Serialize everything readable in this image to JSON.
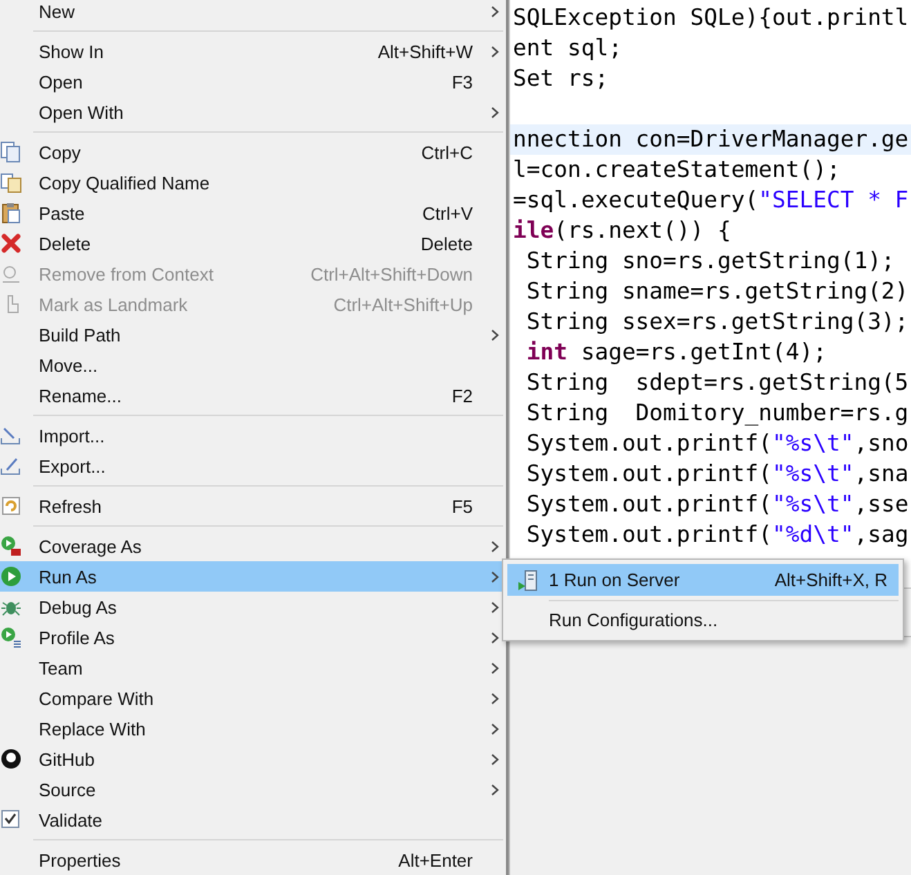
{
  "context_menu": {
    "items": [
      {
        "kind": "item",
        "label": "New",
        "submenu": true,
        "disabled": false,
        "selected": false
      },
      {
        "kind": "separator"
      },
      {
        "kind": "item",
        "label": "Show In",
        "shortcut": "Alt+Shift+W",
        "submenu": true,
        "disabled": false,
        "selected": false
      },
      {
        "kind": "item",
        "label": "Open",
        "shortcut": "F3",
        "submenu": false,
        "disabled": false,
        "selected": false
      },
      {
        "kind": "item",
        "label": "Open With",
        "submenu": true,
        "disabled": false,
        "selected": false
      },
      {
        "kind": "separator"
      },
      {
        "kind": "item",
        "label": "Copy",
        "shortcut": "Ctrl+C",
        "submenu": false,
        "disabled": false,
        "selected": false
      },
      {
        "kind": "item",
        "label": "Copy Qualified Name",
        "submenu": false,
        "disabled": false,
        "selected": false
      },
      {
        "kind": "item",
        "label": "Paste",
        "shortcut": "Ctrl+V",
        "submenu": false,
        "disabled": false,
        "selected": false
      },
      {
        "kind": "item",
        "label": "Delete",
        "shortcut": "Delete",
        "submenu": false,
        "disabled": false,
        "selected": false
      },
      {
        "kind": "item",
        "label": "Remove from Context",
        "shortcut": "Ctrl+Alt+Shift+Down",
        "submenu": false,
        "disabled": true,
        "selected": false
      },
      {
        "kind": "item",
        "label": "Mark as Landmark",
        "shortcut": "Ctrl+Alt+Shift+Up",
        "submenu": false,
        "disabled": true,
        "selected": false
      },
      {
        "kind": "item",
        "label": "Build Path",
        "submenu": true,
        "disabled": false,
        "selected": false
      },
      {
        "kind": "item",
        "label": "Move...",
        "submenu": false,
        "disabled": false,
        "selected": false
      },
      {
        "kind": "item",
        "label": "Rename...",
        "shortcut": "F2",
        "submenu": false,
        "disabled": false,
        "selected": false
      },
      {
        "kind": "separator"
      },
      {
        "kind": "item",
        "label": "Import...",
        "submenu": false,
        "disabled": false,
        "selected": false
      },
      {
        "kind": "item",
        "label": "Export...",
        "submenu": false,
        "disabled": false,
        "selected": false
      },
      {
        "kind": "separator"
      },
      {
        "kind": "item",
        "label": "Refresh",
        "shortcut": "F5",
        "submenu": false,
        "disabled": false,
        "selected": false
      },
      {
        "kind": "separator"
      },
      {
        "kind": "item",
        "label": "Coverage As",
        "submenu": true,
        "disabled": false,
        "selected": false
      },
      {
        "kind": "item",
        "label": "Run As",
        "submenu": true,
        "disabled": false,
        "selected": true
      },
      {
        "kind": "item",
        "label": "Debug As",
        "submenu": true,
        "disabled": false,
        "selected": false
      },
      {
        "kind": "item",
        "label": "Profile As",
        "submenu": true,
        "disabled": false,
        "selected": false
      },
      {
        "kind": "item",
        "label": "Team",
        "submenu": true,
        "disabled": false,
        "selected": false
      },
      {
        "kind": "item",
        "label": "Compare With",
        "submenu": true,
        "disabled": false,
        "selected": false
      },
      {
        "kind": "item",
        "label": "Replace With",
        "submenu": true,
        "disabled": false,
        "selected": false
      },
      {
        "kind": "item",
        "label": "GitHub",
        "submenu": true,
        "disabled": false,
        "selected": false
      },
      {
        "kind": "item",
        "label": "Source",
        "submenu": true,
        "disabled": false,
        "selected": false
      },
      {
        "kind": "item",
        "label": "Validate",
        "submenu": false,
        "disabled": false,
        "selected": false
      },
      {
        "kind": "separator"
      },
      {
        "kind": "item",
        "label": "Properties",
        "shortcut": "Alt+Enter",
        "submenu": false,
        "disabled": false,
        "selected": false
      }
    ]
  },
  "run_as_submenu": {
    "items": [
      {
        "kind": "item",
        "label": "1 Run on Server",
        "shortcut": "Alt+Shift+X, R",
        "selected": true
      },
      {
        "kind": "separator"
      },
      {
        "kind": "item",
        "label": "Run Configurations...",
        "selected": false
      }
    ]
  },
  "code_editor": {
    "lines": [
      {
        "current": false,
        "segments": [
          {
            "kind": "plain",
            "text": "SQLException SQLe){out.printl"
          }
        ]
      },
      {
        "current": false,
        "segments": [
          {
            "kind": "plain",
            "text": "ent sql;"
          }
        ]
      },
      {
        "current": false,
        "segments": [
          {
            "kind": "plain",
            "text": "Set rs;"
          }
        ]
      },
      {
        "current": false
      },
      {
        "current": true,
        "segments": [
          {
            "kind": "plain",
            "text": "nnection con=DriverManager.ge"
          }
        ]
      },
      {
        "current": false,
        "segments": [
          {
            "kind": "plain",
            "text": "l=con.createStatement();"
          }
        ]
      },
      {
        "current": false,
        "segments": [
          {
            "kind": "plain",
            "text": "=sql.executeQuery("
          },
          {
            "kind": "string",
            "text": "\"SELECT * F"
          }
        ]
      },
      {
        "current": false,
        "segments": [
          {
            "kind": "keyword",
            "text": "ile"
          },
          {
            "kind": "plain",
            "text": "(rs.next()) {"
          }
        ]
      },
      {
        "current": false,
        "segments": [
          {
            "kind": "plain",
            "text": " String sno=rs.getString(1);"
          }
        ]
      },
      {
        "current": false,
        "segments": [
          {
            "kind": "plain",
            "text": " String sname=rs.getString(2)"
          }
        ]
      },
      {
        "current": false,
        "segments": [
          {
            "kind": "plain",
            "text": " String ssex=rs.getString(3);"
          }
        ]
      },
      {
        "current": false,
        "segments": [
          {
            "kind": "keyword",
            "text": " int"
          },
          {
            "kind": "plain",
            "text": " sage=rs.getInt(4);"
          }
        ]
      },
      {
        "current": false,
        "segments": [
          {
            "kind": "plain",
            "text": " String  sdept=rs.getString(5"
          }
        ]
      },
      {
        "current": false,
        "segments": [
          {
            "kind": "plain",
            "text": " String  Domitory_number=rs.g"
          }
        ]
      },
      {
        "current": false,
        "segments": [
          {
            "kind": "plain",
            "text": " System.out.printf("
          },
          {
            "kind": "string",
            "text": "\"%s\\t\""
          },
          {
            "kind": "plain",
            "text": ",sno"
          }
        ]
      },
      {
        "current": false,
        "segments": [
          {
            "kind": "plain",
            "text": " System.out.printf("
          },
          {
            "kind": "string",
            "text": "\"%s\\t\""
          },
          {
            "kind": "plain",
            "text": ",sna"
          }
        ]
      },
      {
        "current": false,
        "segments": [
          {
            "kind": "plain",
            "text": " System.out.printf("
          },
          {
            "kind": "string",
            "text": "\"%s\\t\""
          },
          {
            "kind": "plain",
            "text": ",sse"
          }
        ]
      },
      {
        "current": false,
        "segments": [
          {
            "kind": "plain",
            "text": " System.out.printf("
          },
          {
            "kind": "string",
            "text": "\"%d\\t\""
          },
          {
            "kind": "plain",
            "text": ",sag"
          }
        ]
      }
    ]
  }
}
